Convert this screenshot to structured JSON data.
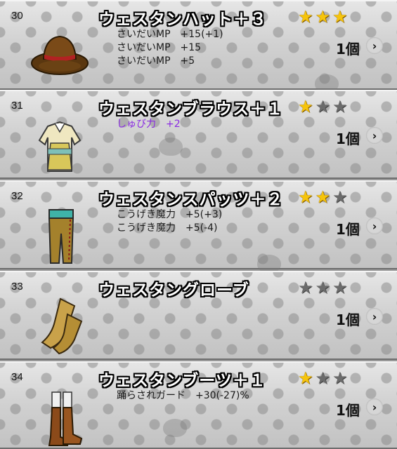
{
  "items": [
    {
      "number": "30",
      "name": "ウェスタンハット＋３",
      "stats": [
        "さいだいMP　+15(+1)",
        "さいだいMP　+15",
        "さいだいMP　+5"
      ],
      "stats_color": "#1a1a1a",
      "stars": [
        true,
        true,
        true
      ],
      "count": "1個",
      "icon": "western-hat-icon"
    },
    {
      "number": "31",
      "name": "ウェスタンブラウス＋１",
      "stats": [
        "しゅび力　+2"
      ],
      "stats_color": "#8a2be2",
      "stars": [
        true,
        false,
        false
      ],
      "count": "1個",
      "icon": "western-blouse-icon"
    },
    {
      "number": "32",
      "name": "ウェスタンスパッツ＋２",
      "stats": [
        "こうげき魔力　+5(+3)",
        "こうげき魔力　+5(-4)"
      ],
      "stats_color": "#1a1a1a",
      "stars": [
        true,
        true,
        false
      ],
      "count": "1個",
      "icon": "western-pants-icon"
    },
    {
      "number": "33",
      "name": "ウェスタングローブ",
      "stats": [],
      "stats_color": "#1a1a1a",
      "stars": [
        false,
        false,
        false
      ],
      "count": "1個",
      "icon": "western-gloves-icon"
    },
    {
      "number": "34",
      "name": "ウェスタンブーツ＋１",
      "stats": [
        "踊らされガード　+30(-27)%"
      ],
      "stats_color": "#1a1a1a",
      "stars": [
        true,
        false,
        false
      ],
      "count": "1個",
      "icon": "western-boots-icon"
    }
  ],
  "colors": {
    "star_on": "#f6c40c",
    "star_off": "#6b6b6b",
    "name_text": "#ffffff",
    "background": "#d2d2d2"
  }
}
